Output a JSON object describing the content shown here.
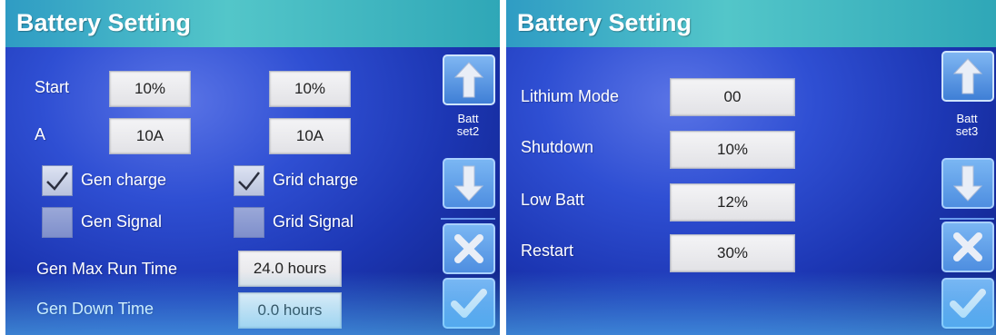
{
  "left_screen": {
    "title": "Battery Setting",
    "rows": [
      {
        "label": "Start",
        "value1": "10%",
        "value2": "10%"
      },
      {
        "label": "A",
        "value1": "10A",
        "value2": "10A"
      }
    ],
    "checks": [
      {
        "label": "Gen charge",
        "checked": true
      },
      {
        "label": "Grid charge",
        "checked": true
      },
      {
        "label": "Gen Signal",
        "checked": false
      },
      {
        "label": "Grid Signal",
        "checked": false
      }
    ],
    "gen_max_run_label": "Gen Max Run Time",
    "gen_max_run_value": "24.0 hours",
    "gen_down_label": "Gen Down Time",
    "gen_down_value": "0.0 hours",
    "side_label_line1": "Batt",
    "side_label_line2": "set2"
  },
  "right_screen": {
    "title": "Battery Setting",
    "fields": [
      {
        "label": "Lithium Mode",
        "value": "00"
      },
      {
        "label": "Shutdown",
        "value": "10%"
      },
      {
        "label": "Low Batt",
        "value": "12%"
      },
      {
        "label": "Restart",
        "value": "30%"
      }
    ],
    "side_label_line1": "Batt",
    "side_label_line2": "set3"
  },
  "icons": {
    "up": "arrow-up-icon",
    "down": "arrow-down-icon",
    "cancel": "close-icon",
    "confirm": "check-icon"
  }
}
